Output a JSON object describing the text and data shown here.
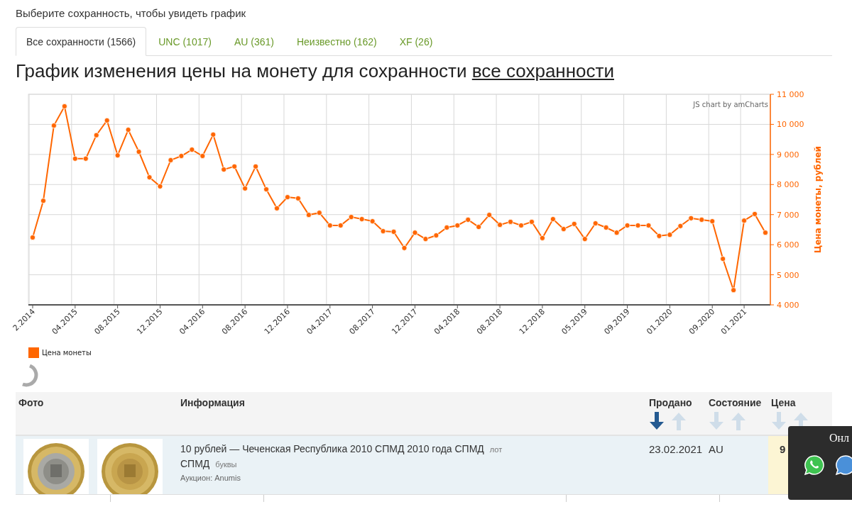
{
  "prompt": "Выберите сохранность, чтобы увидеть график",
  "tabs": [
    {
      "label": "Все сохранности (1566)",
      "selected": true
    },
    {
      "label": "UNC (1017)",
      "selected": false
    },
    {
      "label": "AU (361)",
      "selected": false
    },
    {
      "label": "Неизвестно (162)",
      "selected": false
    },
    {
      "label": "XF (26)",
      "selected": false
    }
  ],
  "heading": {
    "text": "График изменения цены на монету для сохранности ",
    "link": "все сохранности"
  },
  "chart": {
    "credit": "JS chart by amCharts",
    "chart_data": {
      "type": "line",
      "grid": true,
      "ylabel": "Цена монеты, рублей",
      "ylim": [
        4000,
        11000
      ],
      "yticks": [
        {
          "value": 4000,
          "label": "4 000"
        },
        {
          "value": 5000,
          "label": "5 000"
        },
        {
          "value": 6000,
          "label": "6 000"
        },
        {
          "value": 7000,
          "label": "7 000"
        },
        {
          "value": 8000,
          "label": "8 000"
        },
        {
          "value": 9000,
          "label": "9 000"
        },
        {
          "value": 10000,
          "label": "10 000"
        },
        {
          "value": 11000,
          "label": "11 000"
        }
      ],
      "categories": [
        "2.2014",
        null,
        null,
        null,
        "04.2015",
        null,
        null,
        null,
        "08.2015",
        null,
        null,
        null,
        "12.2015",
        null,
        null,
        null,
        "04.2016",
        null,
        null,
        null,
        "08.2016",
        null,
        null,
        null,
        "12.2016",
        null,
        null,
        null,
        "04.2017",
        null,
        null,
        null,
        "08.2017",
        null,
        null,
        null,
        "12.2017",
        null,
        null,
        null,
        "04.2018",
        null,
        null,
        null,
        "08.2018",
        null,
        null,
        null,
        "12.2018",
        null,
        null,
        null,
        "05.2019",
        null,
        null,
        null,
        "09.2019",
        null,
        null,
        null,
        "01.2020",
        null,
        null,
        null,
        "09.2020",
        null,
        null,
        "01.2021",
        null,
        null
      ],
      "series": [
        {
          "name": "Цена монеты",
          "color": "#ff6600",
          "marker": true,
          "values": [
            6240,
            7460,
            9960,
            10600,
            8860,
            8860,
            9640,
            10130,
            8970,
            9820,
            9090,
            8240,
            7940,
            8810,
            8950,
            9160,
            8950,
            9660,
            8500,
            8600,
            7870,
            8600,
            7840,
            7210,
            7580,
            7540,
            6990,
            7060,
            6640,
            6640,
            6920,
            6850,
            6780,
            6450,
            6430,
            5890,
            6400,
            6190,
            6310,
            6570,
            6640,
            6830,
            6590,
            6990,
            6660,
            6760,
            6640,
            6760,
            6220,
            6850,
            6520,
            6690,
            6190,
            6710,
            6570,
            6400,
            6640,
            6640,
            6640,
            6290,
            6330,
            6620,
            6880,
            6830,
            6780,
            5530,
            4490,
            6800,
            7020,
            6400
          ]
        }
      ]
    }
  },
  "table": {
    "columns": [
      {
        "label": "Фото"
      },
      {
        "label": "Информация"
      },
      {
        "label": "Продано",
        "sort_down_selected": true,
        "sort_up_selected": false
      },
      {
        "label": "Состояние",
        "sort_down_selected": false,
        "sort_up_selected": false
      },
      {
        "label": "Цена",
        "sort_down_selected": false,
        "sort_up_selected": false
      }
    ],
    "rows": [
      {
        "title": "10 рублей — Чеченская Республика 2010 СПМД 2010 года СПМД",
        "lot": "лот",
        "title_end": "СПМД",
        "letters": "буквы",
        "auction": "Аукцион: Anumis",
        "sold": "23.02.2021",
        "condition": "AU",
        "price": "9"
      }
    ]
  },
  "share_popup": {
    "title": "Онл"
  }
}
